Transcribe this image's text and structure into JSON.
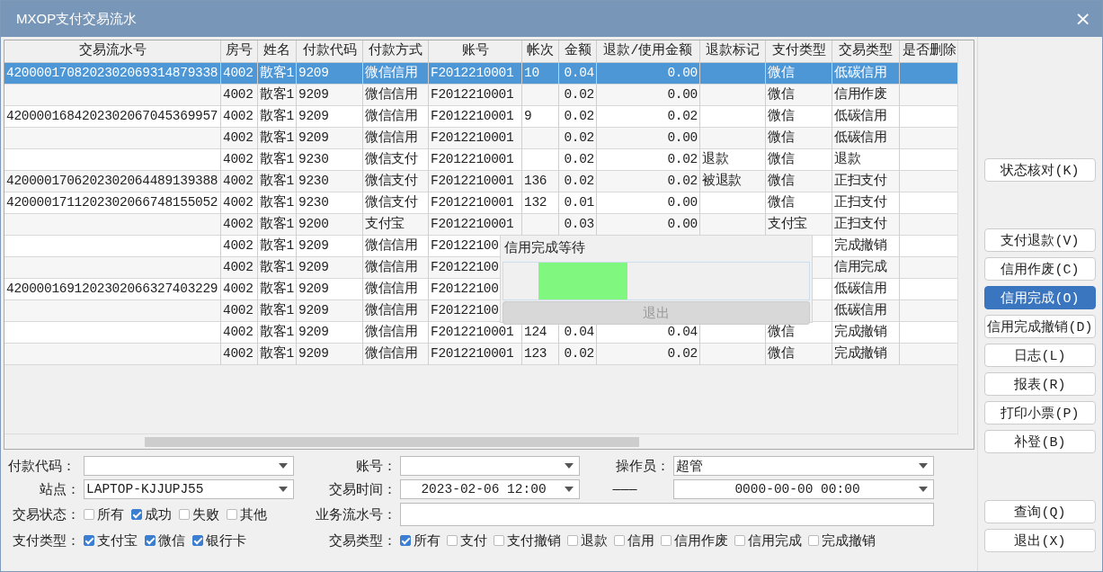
{
  "window": {
    "title": "MXOP支付交易流水",
    "close": "×"
  },
  "table": {
    "columns": [
      "交易流水号",
      "房号",
      "姓名",
      "付款代码",
      "付款方式",
      "账号",
      "帐次",
      "金额",
      "退款/使用金额",
      "退款标记",
      "支付类型",
      "交易类型",
      "是否删除"
    ],
    "rows": [
      {
        "selected": true,
        "cells": [
          "4200001708202302069314879338",
          "4002",
          "散客1",
          "9209",
          "微信信用",
          "F2012210001",
          "10",
          "0.04",
          "0.00",
          "",
          "微信",
          "低碳信用",
          ""
        ]
      },
      {
        "selected": false,
        "cells": [
          "",
          "4002",
          "散客1",
          "9209",
          "微信信用",
          "F2012210001",
          "",
          "0.02",
          "0.00",
          "",
          "微信",
          "信用作废",
          ""
        ]
      },
      {
        "selected": false,
        "cells": [
          "4200001684202302067045369957",
          "4002",
          "散客1",
          "9209",
          "微信信用",
          "F2012210001",
          "9",
          "0.02",
          "0.02",
          "",
          "微信",
          "低碳信用",
          ""
        ]
      },
      {
        "selected": false,
        "cells": [
          "",
          "4002",
          "散客1",
          "9209",
          "微信信用",
          "F2012210001",
          "",
          "0.02",
          "0.00",
          "",
          "微信",
          "低碳信用",
          ""
        ]
      },
      {
        "selected": false,
        "cells": [
          "",
          "4002",
          "散客1",
          "9230",
          "微信支付",
          "F2012210001",
          "",
          "0.02",
          "0.02",
          "退款",
          "微信",
          "退款",
          ""
        ]
      },
      {
        "selected": false,
        "cells": [
          "4200001706202302064489139388",
          "4002",
          "散客1",
          "9230",
          "微信支付",
          "F2012210001",
          "136",
          "0.02",
          "0.02",
          "被退款",
          "微信",
          "正扫支付",
          ""
        ]
      },
      {
        "selected": false,
        "cells": [
          "4200001711202302066748155052",
          "4002",
          "散客1",
          "9230",
          "微信支付",
          "F2012210001",
          "132",
          "0.01",
          "0.00",
          "",
          "微信",
          "正扫支付",
          ""
        ]
      },
      {
        "selected": false,
        "cells": [
          "",
          "4002",
          "散客1",
          "9200",
          "支付宝",
          "F2012210001",
          "",
          "0.03",
          "0.00",
          "",
          "支付宝",
          "正扫支付",
          ""
        ]
      },
      {
        "selected": false,
        "cells": [
          "",
          "4002",
          "散客1",
          "9209",
          "微信信用",
          "F20122100",
          "",
          "",
          "",
          "",
          "",
          "完成撤销",
          ""
        ]
      },
      {
        "selected": false,
        "cells": [
          "",
          "4002",
          "散客1",
          "9209",
          "微信信用",
          "F20122100",
          "",
          "",
          "",
          "",
          "",
          "信用完成",
          ""
        ]
      },
      {
        "selected": false,
        "cells": [
          "4200001691202302066327403229",
          "4002",
          "散客1",
          "9209",
          "微信信用",
          "F20122100",
          "",
          "",
          "",
          "",
          "",
          "低碳信用",
          ""
        ]
      },
      {
        "selected": false,
        "cells": [
          "",
          "4002",
          "散客1",
          "9209",
          "微信信用",
          "F20122100",
          "",
          "",
          "",
          "",
          "",
          "低碳信用",
          ""
        ]
      },
      {
        "selected": false,
        "cells": [
          "",
          "4002",
          "散客1",
          "9209",
          "微信信用",
          "F2012210001",
          "124",
          "0.04",
          "0.04",
          "",
          "微信",
          "完成撤销",
          ""
        ]
      },
      {
        "selected": false,
        "cells": [
          "",
          "4002",
          "散客1",
          "9209",
          "微信信用",
          "F2012210001",
          "123",
          "0.02",
          "0.02",
          "",
          "微信",
          "完成撤销",
          ""
        ]
      }
    ]
  },
  "dialog": {
    "title": "信用完成等待",
    "progress": {
      "level": 0.29
    },
    "button": {
      "label": "退出",
      "disabled": true
    }
  },
  "side_buttons": [
    [
      {
        "label": "状态核对(K)",
        "selected": false
      }
    ],
    [
      {
        "label": "支付退款(V)",
        "selected": false
      },
      {
        "label": "信用作废(C)",
        "selected": false
      },
      {
        "label": "信用完成(O)",
        "selected": true
      },
      {
        "label": "信用完成撤销(D)",
        "selected": false
      },
      {
        "label": "日志(L)",
        "selected": false
      },
      {
        "label": "报表(R)",
        "selected": false
      },
      {
        "label": "打印小票(P)",
        "selected": false
      },
      {
        "label": "补登(B)",
        "selected": false
      }
    ],
    [
      {
        "label": "查询(Q)",
        "selected": false
      },
      {
        "label": "退出(X)",
        "selected": false
      }
    ]
  ],
  "filters": {
    "payment_code": {
      "label": "付款代码："
    },
    "account": {
      "label": "账号："
    },
    "operator": {
      "label": "操作员：",
      "value": "超管"
    },
    "station": {
      "label": "站点：",
      "value": "LAPTOP-KJJUPJ55"
    },
    "trade_time": {
      "label": "交易时间：",
      "value": "2023-02-06 12:00"
    },
    "time_separator": "———",
    "end_time": {
      "value": "0000-00-00 00:00"
    },
    "serial_no": {
      "label": "业务流水号："
    },
    "trade_status": {
      "label": "交易状态：",
      "options": [
        {
          "label": "所有",
          "checked": false
        },
        {
          "label": "成功",
          "checked": true
        },
        {
          "label": "失败",
          "checked": false
        },
        {
          "label": "其他",
          "checked": false
        }
      ]
    },
    "pay_type": {
      "label": "支付类型：",
      "options": [
        {
          "label": "支付宝",
          "checked": true
        },
        {
          "label": "微信",
          "checked": true
        },
        {
          "label": "银行卡",
          "checked": true
        }
      ]
    },
    "trade_type": {
      "label": "交易类型：",
      "options": [
        {
          "label": "所有",
          "checked": true
        },
        {
          "label": "支付",
          "checked": false
        },
        {
          "label": "支付撤销",
          "checked": false
        },
        {
          "label": "退款",
          "checked": false
        },
        {
          "label": "信用",
          "checked": false
        },
        {
          "label": "信用作废",
          "checked": false
        },
        {
          "label": "信用完成",
          "checked": false
        },
        {
          "label": "完成撤销",
          "checked": false
        }
      ]
    }
  }
}
